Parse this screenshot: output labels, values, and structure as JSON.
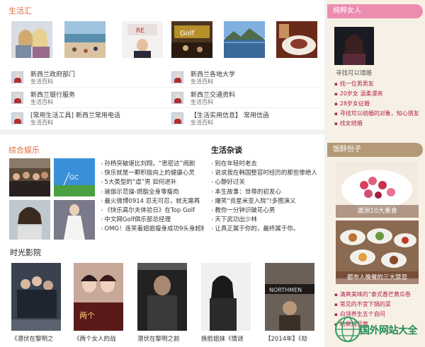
{
  "sections": {
    "shenghuohui": "生活汇",
    "yule": "综合娱乐",
    "zatan": "生活杂谈",
    "yingshi": "时光影院",
    "chunzui": "纯粹女人",
    "yinzui": "饭醉份子"
  },
  "entries": [
    {
      "title": "新西兰政府部门",
      "sub": "生活百科"
    },
    {
      "title": "新西兰银行服务",
      "sub": "生活百科"
    },
    {
      "title": "[常用生活工具] 新西兰常用电话",
      "sub": "生活百科"
    },
    {
      "title": "新西兰各地大学",
      "sub": "生活百科"
    },
    {
      "title": "新西兰交通资料",
      "sub": "生活百科"
    },
    {
      "title": "【生活实用信息】 常用信函",
      "sub": "生活百科"
    }
  ],
  "yule_news": [
    "孙杨突破堪比刘翔，“思密达”闹剧",
    "快乐就是一颗积极向上的健康心灵",
    "5大类型的“虐”男 如何进补",
    "瑜伽示范操-燃脂全身零瘦肉",
    "最火微博0914 忍无可忍，就无需再",
    "《快乐高尔夫体验日》在Top Golf",
    "中文网Golf俱乐部总经理",
    "OMG！连笑着姐姐瘦身成功9头身超模"
  ],
  "zatan_news": [
    "别在年轻时老去",
    "说说我在韩国整容时经历的那些惨绝人",
    "心静好过关",
    "本生故事：世尊的初发心",
    "爆笑“竞星米亚入院”!多图演义",
    "教你一分钟识破花心男",
    "天下武功出少林",
    "让真正属于你的，最终属于你。"
  ],
  "chunzui_caption": "寻找可以靖婚",
  "chunzui_list": [
    "找一位男男友",
    "20岁女 温柔漂亮",
    "28岁女征婚",
    "寻找可以结婚的对象，知心朋友",
    "找女结婚"
  ],
  "food1_caption": "澳洲10大美食",
  "food2_caption": "都市人晚餐的三大禁忌",
  "food_list": [
    "清爽美味的“泰式香芒黄瓜卷",
    "常见的不宜下锅的菜",
    "白领养生五个自问",
    "蛤蜊炖豆腐"
  ],
  "movies": [
    "《潜伏在黎明之",
    "《两个女人的战",
    "潜伏在黎明之前",
    "换脸姐妹《情谜",
    "【2014年】《劫"
  ],
  "watermark": "国外网站大全"
}
